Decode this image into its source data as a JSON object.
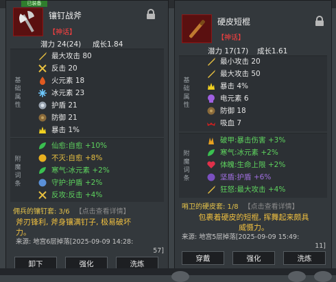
{
  "left": {
    "tag": "已装备",
    "name": "镶钉战斧",
    "rarity": "【神话】",
    "potential": "潜力 24(24)",
    "growth": "成长1.84",
    "base_label": [
      "基",
      "础",
      "属",
      "性"
    ],
    "stats": [
      {
        "icon": "sword-icon",
        "text": "最大攻击 80"
      },
      {
        "icon": "counter-icon",
        "text": "反击 20"
      },
      {
        "icon": "fire-icon",
        "text": "火元素 18"
      },
      {
        "icon": "ice-icon",
        "text": "冰元素 23"
      },
      {
        "icon": "shield-icon",
        "text": "护盾 21"
      },
      {
        "icon": "defense-icon",
        "text": "防御 21"
      },
      {
        "icon": "crit-icon",
        "text": "暴击 1%"
      }
    ],
    "enchant_label": [
      "附",
      "魔",
      "词",
      "条"
    ],
    "enchants": [
      {
        "icon": "leaf-icon",
        "text": "仙愈:自愈 +10%"
      },
      {
        "icon": "orb-icon",
        "text": "不灭:自愈 +8%"
      },
      {
        "icon": "leaf-icon",
        "text": "寒气:冰元素 +2%"
      },
      {
        "icon": "orb-icon",
        "text": "守护:护盾 +2%"
      },
      {
        "icon": "counter-icon",
        "text": "反攻:反击 +4%"
      }
    ],
    "set_name": "佣兵的镶钉套: 3/6",
    "set_hint": "【点击查看详情】",
    "description": [
      "斧刃锋利, 斧身镶满钉子, 极易破坏",
      "力。"
    ],
    "source": [
      "来源: 地宫6层掉落[2025-09-09 14:28:",
      "57]"
    ],
    "buttons": {
      "unequip": "卸下",
      "enhance": "强化",
      "refine": "洗炼"
    }
  },
  "right": {
    "name": "硬皮短棍",
    "rarity": "【神话】",
    "potential": "潜力 17(17)",
    "growth": "成长1.61",
    "base_label": [
      "基",
      "础",
      "属",
      "性"
    ],
    "stats": [
      {
        "icon": "sword-icon",
        "text": "最小攻击 20"
      },
      {
        "icon": "sword-icon",
        "text": "最大攻击 50"
      },
      {
        "icon": "crit-icon",
        "text": "暴击 4%"
      },
      {
        "icon": "electric-icon",
        "text": "电元素 6"
      },
      {
        "icon": "defense-icon",
        "text": "防御 18"
      },
      {
        "icon": "bat-icon",
        "text": "吸血 7"
      }
    ],
    "enchant_label": [
      "附",
      "魔",
      "词",
      "条"
    ],
    "enchants": [
      {
        "icon": "flame-icon",
        "text": "破甲:暴击伤害 +3%"
      },
      {
        "icon": "leaf-icon",
        "text": "寒气:冰元素 +2%"
      },
      {
        "icon": "heart-icon",
        "text": "体魄:生命上限 +2%"
      },
      {
        "icon": "orb-icon",
        "text": "坚盾:护盾 +6%"
      },
      {
        "icon": "sword-icon",
        "text": "狂怒:最大攻击 +4%"
      }
    ],
    "set_name": "哨卫的硬皮套: 1/8",
    "set_hint": "【点击查看详情】",
    "description": [
      "包裹着硬皮的短棍, 挥舞起来颇具",
      "威慑力。"
    ],
    "source": [
      "来源: 地宫5层掉落[2025-09-09 15:49:",
      "11]"
    ],
    "buttons": {
      "equip": "穿戴",
      "enhance": "强化",
      "refine": "洗炼"
    }
  }
}
